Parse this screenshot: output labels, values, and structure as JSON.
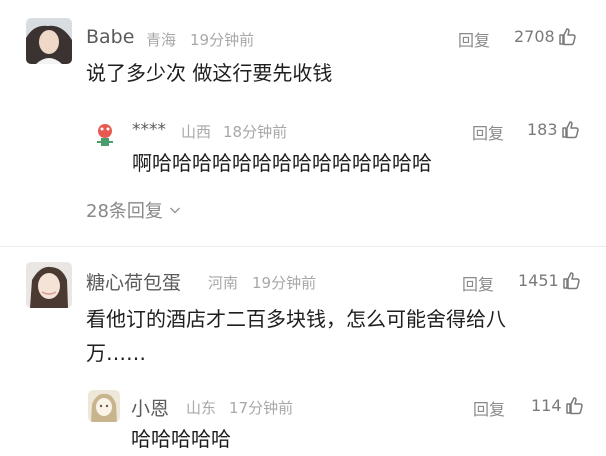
{
  "reply_label": "回复",
  "accent_colors": {
    "name": "#5b5b5b",
    "meta": "#a8a8a8",
    "text": "#1e1e1e"
  },
  "comments": [
    {
      "username": "Babe",
      "location": "青海",
      "time": "19分钟前",
      "likes": "2708",
      "lines": [
        "说了多少次 做这行要先收钱"
      ],
      "more_replies": "28条回复",
      "replies": [
        {
          "username": "****",
          "location": "山西",
          "time": "18分钟前",
          "likes": "183",
          "lines": [
            "啊哈哈哈哈哈哈哈哈哈哈哈哈哈哈"
          ]
        }
      ]
    },
    {
      "username": "糖心荷包蛋",
      "location": "河南",
      "time": "19分钟前",
      "likes": "1451",
      "lines": [
        "看他订的酒店才二百多块钱，怎么可能舍得给八",
        "万……"
      ],
      "replies": [
        {
          "username": "小恩",
          "location": "山东",
          "time": "17分钟前",
          "likes": "114",
          "lines": [
            "哈哈哈哈哈"
          ]
        }
      ]
    }
  ]
}
